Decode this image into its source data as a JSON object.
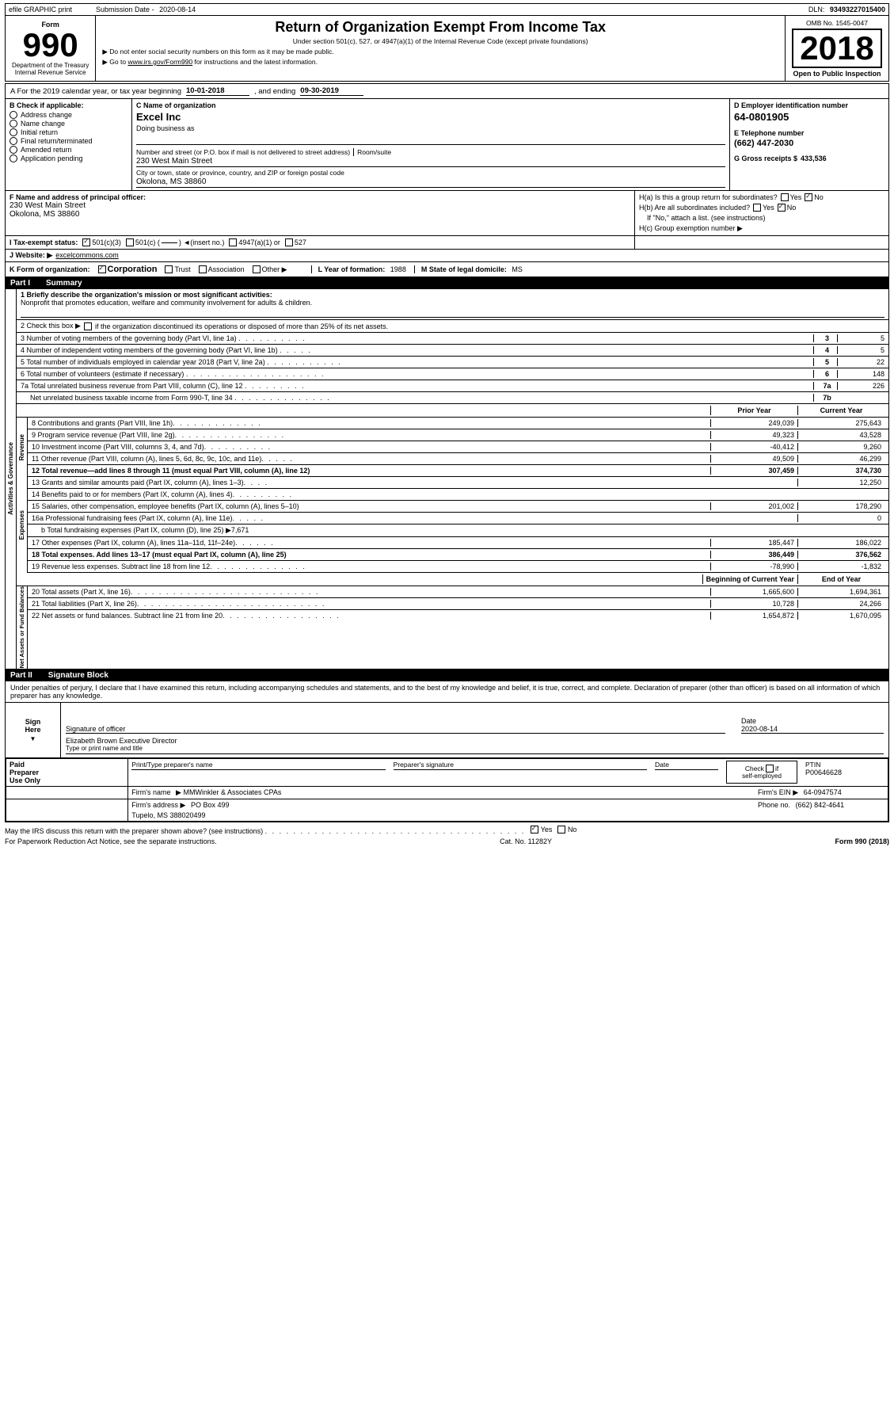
{
  "header": {
    "efile_label": "efile GRAPHIC print",
    "submission_date_label": "Submission Date -",
    "submission_date": "2020-08-14",
    "dln_label": "DLN:",
    "dln": "93493227015400",
    "form_label": "Form",
    "form_number": "990",
    "return_title": "Return of Organization Exempt From Income Tax",
    "subtitle1": "Under section 501(c), 527, or 4947(a)(1) of the Internal Revenue Code (except private foundations)",
    "arrow1": "▶ Do not enter social security numbers on this form as it may be made public.",
    "arrow2": "▶ Go to www.irs.gov/Form990 for instructions and the latest information.",
    "irs_website": "www.irs.gov/Form990",
    "omb_label": "OMB No. 1545-0047",
    "year": "2018",
    "open_public": "Open to Public Inspection",
    "dept_label": "Department of the Treasury",
    "internal_revenue": "Internal Revenue Service"
  },
  "section_a": {
    "text": "A  For the 2019 calendar year, or tax year beginning",
    "beginning_date": "10-01-2018",
    "and_ending": ", and ending",
    "ending_date": "09-30-2019"
  },
  "section_b": {
    "label": "B Check if applicable:",
    "items": [
      {
        "label": "Address change",
        "checked": false
      },
      {
        "label": "Name change",
        "checked": false
      },
      {
        "label": "Initial return",
        "checked": false
      },
      {
        "label": "Final return/terminated",
        "checked": false
      },
      {
        "label": "Amended return",
        "checked": false
      },
      {
        "label": "Application pending",
        "checked": false
      }
    ]
  },
  "section_c": {
    "label": "C Name of organization",
    "org_name": "Excel Inc",
    "dba_label": "Doing business as",
    "address_label": "Number and street (or P.O. box if mail is not delivered to street address)",
    "address": "230 West Main Street",
    "room_suite_label": "Room/suite",
    "city_label": "City or town, state or province, country, and ZIP or foreign postal code",
    "city": "Okolona, MS  38860"
  },
  "section_d": {
    "label": "D Employer identification number",
    "ein": "64-0801905"
  },
  "section_e": {
    "label": "E Telephone number",
    "phone": "(662) 447-2030"
  },
  "section_g": {
    "label": "G Gross receipts $",
    "amount": "433,536"
  },
  "section_f": {
    "label": "F Name and address of principal officer:",
    "address": "230 West Main Street",
    "city": "Okolona, MS  38860"
  },
  "section_h": {
    "ha_label": "H(a) Is this a group return for subordinates?",
    "ha_yes": "Yes",
    "ha_no": "No",
    "ha_checked": "No",
    "hb_label": "H(b) Are all subordinates included?",
    "hb_yes": "Yes",
    "hb_no": "No",
    "hb_note": "If \"No,\" attach a list. (see instructions)",
    "hc_label": "H(c) Group exemption number ▶"
  },
  "section_i": {
    "label": "I  Tax-exempt status:",
    "options": [
      {
        "label": "501(c)(3)",
        "checked": true
      },
      {
        "label": "501(c) (",
        "checked": false
      },
      {
        "insert_label": ") ◄(insert no.)",
        "checked": false
      },
      {
        "label": "4947(a)(1) or",
        "checked": false
      },
      {
        "label": "527",
        "checked": false
      }
    ]
  },
  "section_j": {
    "label": "J  Website: ▶",
    "website": "excelcommons.com"
  },
  "section_k": {
    "label": "K Form of organization:",
    "options": [
      {
        "label": "Corporation",
        "checked": true
      },
      {
        "label": "Trust",
        "checked": false
      },
      {
        "label": "Association",
        "checked": false
      },
      {
        "label": "Other ▶",
        "checked": false
      }
    ]
  },
  "section_l": {
    "label": "L Year of formation:",
    "year": "1988"
  },
  "section_m": {
    "label": "M State of legal domicile:",
    "state": "MS"
  },
  "part1": {
    "title": "Part I",
    "subtitle": "Summary",
    "line1_label": "1  Briefly describe the organization's mission or most significant activities:",
    "line1_text": "Nonprofit that promotes education, welfare and community involvement for adults & children.",
    "line2_label": "2  Check this box ▶",
    "line2_text": "if the organization discontinued its operations or disposed of more than 25% of its net assets.",
    "line3_label": "3  Number of voting members of the governing body (Part VI, line 1a)",
    "line3_dots": ". . . . . . . . . .",
    "line3_num": "3",
    "line3_val": "5",
    "line4_label": "4  Number of independent voting members of the governing body (Part VI, line 1b)",
    "line4_dots": ". . . . .",
    "line4_num": "4",
    "line4_val": "5",
    "line5_label": "5  Total number of individuals employed in calendar year 2018 (Part V, line 2a)",
    "line5_dots": ". . . . . . . . . . .",
    "line5_num": "5",
    "line5_val": "22",
    "line6_label": "6  Total number of volunteers (estimate if necessary)",
    "line6_dots": ". . . . . . . . . . . . . . . . . . . .",
    "line6_num": "6",
    "line6_val": "148",
    "line7a_label": "7a Total unrelated business revenue from Part VIII, column (C), line 12",
    "line7a_dots": ". . . . . . . . .",
    "line7a_num": "7a",
    "line7a_val": "226",
    "line7b_label": "Net unrelated business taxable income from Form 990-T, line 34",
    "line7b_dots": ". . . . . . . . . . . . . .",
    "line7b_num": "7b",
    "line7b_val": "",
    "prior_year": "Prior Year",
    "current_year": "Current Year",
    "line8_label": "8  Contributions and grants (Part VIII, line 1h)",
    "line8_dots": ". . . . . . . . . . . . .",
    "line8_prior": "249,039",
    "line8_current": "275,643",
    "line9_label": "9  Program service revenue (Part VIII, line 2g)",
    "line9_dots": ". . . . . . . . . . . . . . . .",
    "line9_prior": "49,323",
    "line9_current": "43,528",
    "line10_label": "10  Investment income (Part VIII, columns 3, 4, and 7d)",
    "line10_dots": ". . . . . . . . . .",
    "line10_prior": "-40,412",
    "line10_current": "9,260",
    "line11_label": "11  Other revenue (Part VIII, column (A), lines 5, 6d, 8c, 9c, 10c, and 11e)",
    "line11_dots": ". . . . .",
    "line11_prior": "49,509",
    "line11_current": "46,299",
    "line12_label": "12  Total revenue—add lines 8 through 11 (must equal Part VIII, column (A), line 12)",
    "line12_prior": "307,459",
    "line12_current": "374,730",
    "line13_label": "13  Grants and similar amounts paid (Part IX, column (A), lines 1–3)",
    "line13_dots": ". . . .",
    "line13_prior": "",
    "line13_current": "12,250",
    "line14_label": "14  Benefits paid to or for members (Part IX, column (A), lines 4)",
    "line14_dots": ". . . . . . . . .",
    "line14_prior": "",
    "line14_current": "",
    "line15_label": "15  Salaries, other compensation, employee benefits (Part IX, column (A), lines 5–10)",
    "line15_prior": "201,002",
    "line15_current": "178,290",
    "line16a_label": "16a Professional fundraising fees (Part IX, column (A), line 11e)",
    "line16a_dots": ". . . . .",
    "line16a_prior": "",
    "line16a_current": "0",
    "line16b_label": "b  Total fundraising expenses (Part IX, column (D), line 25) ▶7,671",
    "line17_label": "17  Other expenses (Part IX, column (A), lines 11a–11d, 11f–24e)",
    "line17_dots": ". . . . . .",
    "line17_prior": "185,447",
    "line17_current": "186,022",
    "line18_label": "18  Total expenses. Add lines 13–17 (must equal Part IX, column (A), line 25)",
    "line18_prior": "386,449",
    "line18_current": "376,562",
    "line19_label": "19  Revenue less expenses. Subtract line 18 from line 12",
    "line19_dots": ". . . . . . . . . . . . . .",
    "line19_prior": "-78,990",
    "line19_current": "-1,832",
    "beginning_of_year": "Beginning of Current Year",
    "end_of_year": "End of Year",
    "line20_label": "20  Total assets (Part X, line 16)",
    "line20_dots": ". . . . . . . . . . . . . . . . . . . . . . . . . . .",
    "line20_begin": "1,665,600",
    "line20_end": "1,694,361",
    "line21_label": "21  Total liabilities (Part X, line 26)",
    "line21_dots": ". . . . . . . . . . . . . . . . . . . . . . . . . . .",
    "line21_begin": "10,728",
    "line21_end": "24,266",
    "line22_label": "22  Net assets or fund balances. Subtract line 21 from line 20",
    "line22_dots": ". . . . . . . . . . . . . . . . .",
    "line22_begin": "1,654,872",
    "line22_end": "1,670,095"
  },
  "part2": {
    "title": "Part II",
    "subtitle": "Signature Block",
    "penalty_text": "Under penalties of perjury, I declare that I have examined this return, including accompanying schedules and statements, and to the best of my knowledge and belief, it is true, correct, and complete. Declaration of preparer (other than officer) is based on all information of which preparer has any knowledge.",
    "sign_here": "Sign Here",
    "signature_label": "Signature of officer",
    "date_label": "Date",
    "date_val": "2020-08-14",
    "name_label": "Elizabeth Brown  Executive Director",
    "name_sublabel": "Type or print name and title",
    "preparer_name_label": "Print/Type preparer's name",
    "preparer_sig_label": "Preparer's signature",
    "preparer_date_label": "Date",
    "check_label": "Check",
    "if_label": "if",
    "self_employed": "self-employed",
    "ptin_label": "PTIN",
    "ptin_val": "P00646628",
    "firm_name_label": "Firm's name",
    "firm_name": "▶ MMWinkler & Associates CPAs",
    "firm_ein_label": "Firm's EIN ▶",
    "firm_ein": "64-0947574",
    "firm_address_label": "Firm's address ▶",
    "firm_address": "PO Box 499",
    "firm_city": "Tupelo, MS  388020499",
    "phone_label": "Phone no.",
    "phone": "(662) 842-4641"
  },
  "footer": {
    "discuss_label": "May the IRS discuss this return with the preparer shown above? (see instructions)",
    "discuss_dots": ". . . . . . . . . . . . . . . . . . . . . . . . . . . . . . . . . . . . .",
    "yes": "Yes",
    "no": "No",
    "paperwork_label": "For Paperwork Reduction Act Notice, see the separate instructions.",
    "cat_no": "Cat. No. 11282Y",
    "form_label": "Form 990 (2018)"
  },
  "side_labels": {
    "activities": "Activities & Governance",
    "revenue": "Revenue",
    "expenses": "Expenses",
    "net_assets": "Net Assets or Fund Balances"
  }
}
